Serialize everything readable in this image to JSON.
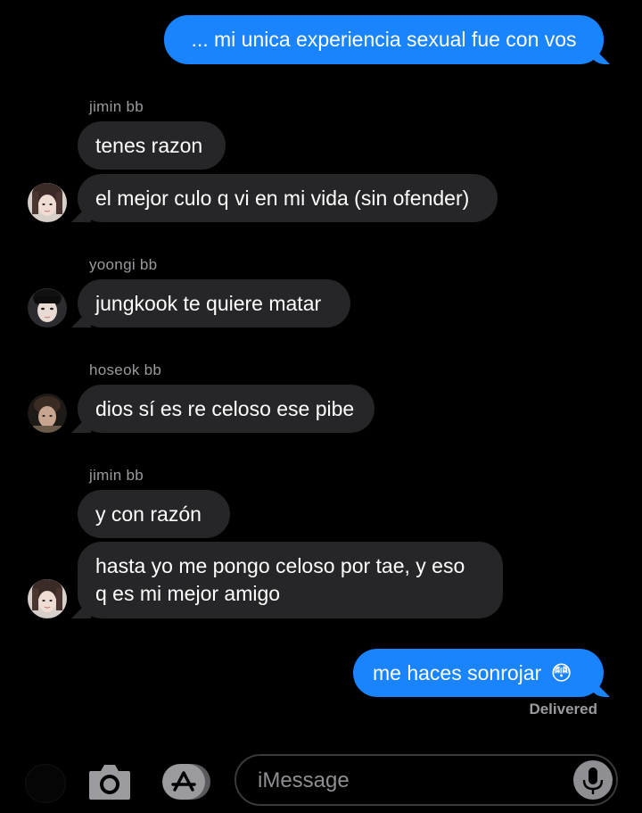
{
  "messages": {
    "m1": "... mi unica experiencia sexual fue con vos",
    "s1": "jimin bb",
    "m2": "tenes razon",
    "m3": "el mejor culo q vi en mi vida (sin ofender)",
    "s2": "yoongi bb",
    "m4": "jungkook te quiere matar",
    "s3": "hoseok bb",
    "m5": "dios sí es re celoso ese pibe",
    "s4": "jimin bb",
    "m6": "y con razón",
    "m7_line1": "hasta yo me pongo celoso por tae, y eso",
    "m7_line2": "q es mi mejor amigo",
    "m8": "me haces sonrojar",
    "m8_emoji": "😳"
  },
  "status": "Delivered",
  "composer": {
    "placeholder": "iMessage"
  },
  "icons": [
    "camera-icon",
    "app-store-icon",
    "microphone-icon"
  ],
  "colors": {
    "outgoing": "#1a84ff",
    "incoming": "#262628",
    "background": "#000000"
  }
}
